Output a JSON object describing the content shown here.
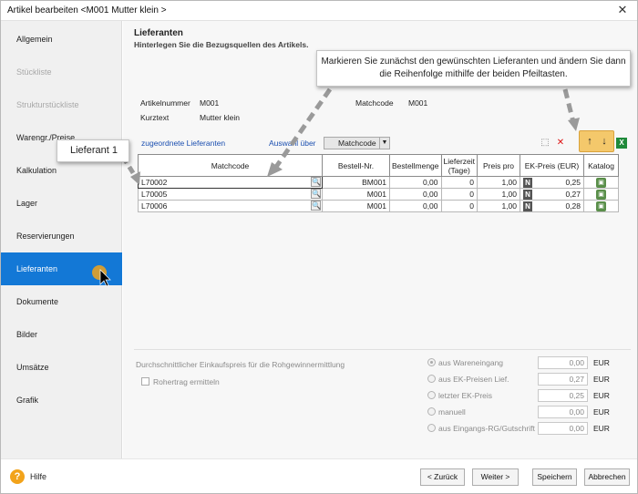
{
  "window": {
    "title": "Artikel bearbeiten <M001 Mutter klein >",
    "close_glyph": "✕"
  },
  "sidebar": {
    "items": [
      {
        "label": "Allgemein",
        "state": "normal"
      },
      {
        "label": "Stückliste",
        "state": "disabled"
      },
      {
        "label": "Strukturstückliste",
        "state": "disabled"
      },
      {
        "label": "Warengr./Preise",
        "state": "normal"
      },
      {
        "label": "Kalkulation",
        "state": "normal"
      },
      {
        "label": "Lager",
        "state": "normal"
      },
      {
        "label": "Reservierungen",
        "state": "normal"
      },
      {
        "label": "Lieferanten",
        "state": "active"
      },
      {
        "label": "Dokumente",
        "state": "normal"
      },
      {
        "label": "Bilder",
        "state": "normal"
      },
      {
        "label": "Umsätze",
        "state": "normal"
      },
      {
        "label": "Grafik",
        "state": "normal"
      }
    ]
  },
  "main": {
    "title": "Lieferanten",
    "subtitle": "Hinterlegen Sie die Bezugsquellen des Artikels.",
    "article": {
      "artikelnummer_label": "Artikelnummer",
      "artikelnummer": "M001",
      "kurztext_label": "Kurztext",
      "kurztext": "Mutter klein",
      "matchcode_label": "Matchcode",
      "matchcode": "M001"
    },
    "toolbar": {
      "assigned_label": "zugeordnete Lieferanten",
      "selection_label": "Auswahl über",
      "selection_value": "Matchcode",
      "up_glyph": "↑",
      "down_glyph": "↓"
    },
    "grid": {
      "headers": [
        "Matchcode",
        "Bestell-Nr.",
        "Bestellmenge",
        "Lieferzeit (Tage)",
        "Preis pro",
        "EK-Preis (EUR)",
        "Katalog"
      ],
      "rows": [
        {
          "matchcode": "L70002",
          "bestellnr": "BM001",
          "menge": "0,00",
          "lieferzeit": "0",
          "preis_pro": "1,00",
          "ek": "0,25"
        },
        {
          "matchcode": "L70005",
          "bestellnr": "M001",
          "menge": "0,00",
          "lieferzeit": "0",
          "preis_pro": "1,00",
          "ek": "0,27"
        },
        {
          "matchcode": "L70006",
          "bestellnr": "M001",
          "menge": "0,00",
          "lieferzeit": "0",
          "preis_pro": "1,00",
          "ek": "0,28"
        }
      ],
      "n_glyph": "N"
    },
    "avg": {
      "label": "Durchschnittlicher Einkaufspreis für die Rohgewinnermittlung",
      "rohertrag_label": "Rohertrag ermitteln",
      "options": [
        {
          "label": "aus Wareneingang",
          "value": "0,00",
          "selected": true
        },
        {
          "label": "aus EK-Preisen Lief.",
          "value": "0,27",
          "selected": false
        },
        {
          "label": "letzter EK-Preis",
          "value": "0,25",
          "selected": false
        },
        {
          "label": "manuell",
          "value": "0,00",
          "selected": false
        },
        {
          "label": "aus Eingangs-RG/Gutschrift",
          "value": "0,00",
          "selected": false
        }
      ],
      "currency": "EUR"
    }
  },
  "footer": {
    "help_glyph": "?",
    "help_label": "Hilfe",
    "back_label": "< Zurück",
    "next_label": "Weiter >",
    "save_label": "Speichern",
    "cancel_label": "Abbrechen"
  },
  "annotations": {
    "callout_text": "Markieren Sie zunächst den gewünschten Lieferanten und ändern Sie dann die Reihenfolge mithilfe der beiden Pfeiltasten.",
    "supplier_callout": "Lieferant 1"
  },
  "colors": {
    "accent": "#1378d6",
    "highlight": "#f4c86b",
    "help": "#f2a31b"
  }
}
